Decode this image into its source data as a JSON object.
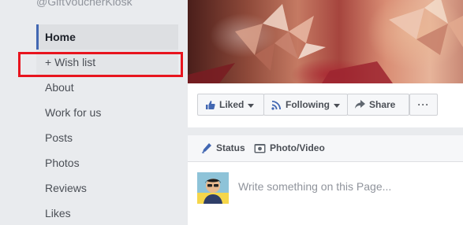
{
  "page": {
    "handle": "@GiftVoucherKiosk"
  },
  "sidebar": {
    "items": [
      {
        "label": "Home"
      },
      {
        "label": "+ Wish list"
      },
      {
        "label": "About"
      },
      {
        "label": "Work for us"
      },
      {
        "label": "Posts"
      },
      {
        "label": "Photos"
      },
      {
        "label": "Reviews"
      },
      {
        "label": "Likes"
      }
    ]
  },
  "actions": {
    "liked_label": "Liked",
    "following_label": "Following",
    "share_label": "Share",
    "more_label": "···"
  },
  "composer": {
    "status_label": "Status",
    "photo_video_label": "Photo/Video",
    "placeholder": "Write something on this Page..."
  },
  "colors": {
    "accent": "#4267b2",
    "highlight": "#e8141e",
    "background": "#e9ebee"
  },
  "icons": [
    "thumbs-up-icon",
    "rss-icon",
    "share-arrow-icon",
    "pencil-icon",
    "camera-icon",
    "caret-down-icon"
  ]
}
